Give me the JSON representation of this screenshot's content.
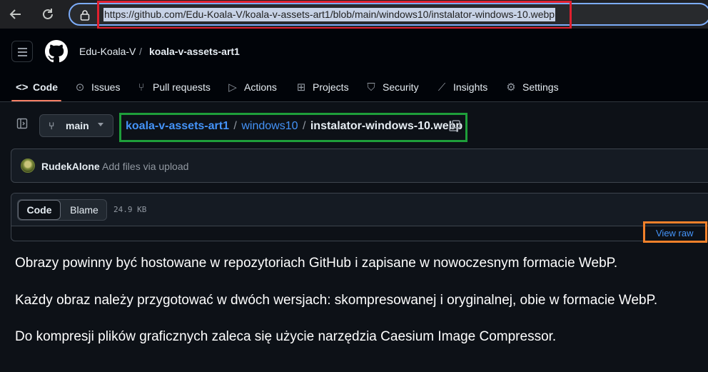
{
  "browser": {
    "url": "https://github.com/Edu-Koala-V/koala-v-assets-art1/blob/main/windows10/instalator-windows-10.webp"
  },
  "header": {
    "owner": "Edu-Koala-V",
    "separator": "/",
    "repo": "koala-v-assets-art1"
  },
  "tabs": [
    {
      "label": "Code",
      "icon": "code-icon",
      "active": true
    },
    {
      "label": "Issues",
      "icon": "issue-icon"
    },
    {
      "label": "Pull requests",
      "icon": "pull-request-icon"
    },
    {
      "label": "Actions",
      "icon": "play-icon"
    },
    {
      "label": "Projects",
      "icon": "table-icon"
    },
    {
      "label": "Security",
      "icon": "shield-icon"
    },
    {
      "label": "Insights",
      "icon": "graph-icon"
    },
    {
      "label": "Settings",
      "icon": "gear-icon"
    }
  ],
  "file_nav": {
    "branch": "main",
    "path_repo": "koala-v-assets-art1",
    "path_dir": "windows10",
    "path_file": "instalator-windows-10.webp",
    "sep": "/"
  },
  "commit": {
    "author": "RudekAlone",
    "message": "Add files via upload"
  },
  "file_view": {
    "code_label": "Code",
    "blame_label": "Blame",
    "size": "24.9 KB",
    "view_raw": "View raw"
  },
  "content": {
    "paragraphs": [
      "Obrazy powinny być hostowane w repozytoriach GitHub i zapisane w nowoczesnym formacie WebP.",
      "Każdy obraz należy przygotować w dwóch wersjach: skompresowanej i oryginalnej, obie w formacie WebP.",
      "Do kompresji plików graficznych zaleca się użycie narzędzia Caesium Image Compressor."
    ]
  },
  "colors": {
    "highlight_url": "#e0202f",
    "highlight_path": "#1e9e3a",
    "highlight_raw": "#f0802a",
    "link": "#4493f8",
    "tab_underline": "#f78166"
  }
}
